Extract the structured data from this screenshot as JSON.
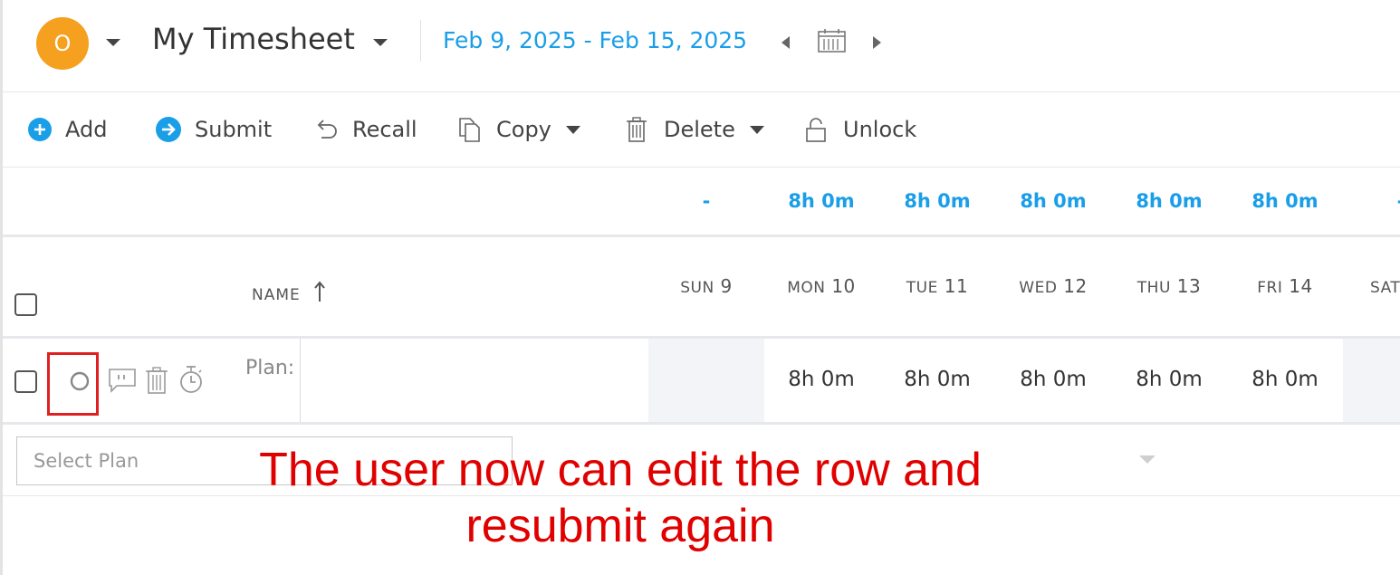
{
  "header": {
    "avatar_initial": "O",
    "title": "My Timesheet",
    "date_range": "Feb 9, 2025 - Feb 15, 2025"
  },
  "toolbar": {
    "add_label": "Add",
    "submit_label": "Submit",
    "recall_label": "Recall",
    "copy_label": "Copy",
    "delete_label": "Delete",
    "unlock_label": "Unlock"
  },
  "totals": [
    "-",
    "8h 0m",
    "8h 0m",
    "8h 0m",
    "8h 0m",
    "8h 0m",
    "-"
  ],
  "columns": {
    "name": "NAME",
    "days": [
      {
        "dow": "SUN",
        "day": "9"
      },
      {
        "dow": "MON",
        "day": "10"
      },
      {
        "dow": "TUE",
        "day": "11"
      },
      {
        "dow": "WED",
        "day": "12"
      },
      {
        "dow": "THU",
        "day": "13"
      },
      {
        "dow": "FRI",
        "day": "14"
      },
      {
        "dow": "SAT",
        "day": ""
      }
    ]
  },
  "row": {
    "plan_label": "Plan:",
    "hours": [
      "",
      "8h 0m",
      "8h 0m",
      "8h 0m",
      "8h 0m",
      "8h 0m",
      ""
    ]
  },
  "new_row": {
    "select_placeholder": "Select Plan"
  },
  "annotation": {
    "line1": "The user now can edit the row and",
    "line2": "resubmit again"
  },
  "colors": {
    "accent": "#1a9ee8",
    "avatar": "#f5a01f",
    "annotation": "#e00000"
  }
}
